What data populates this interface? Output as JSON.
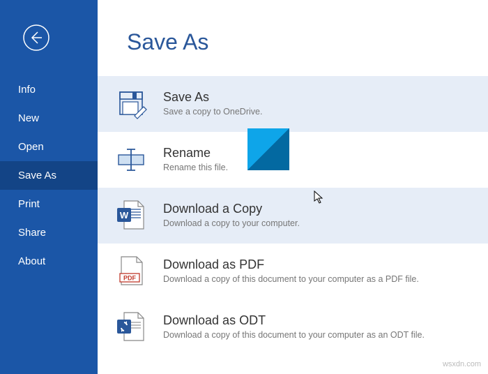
{
  "page_title": "Save As",
  "sidebar": {
    "items": [
      {
        "key": "info",
        "label": "Info",
        "selected": false
      },
      {
        "key": "new",
        "label": "New",
        "selected": false
      },
      {
        "key": "open",
        "label": "Open",
        "selected": false
      },
      {
        "key": "saveas",
        "label": "Save As",
        "selected": true
      },
      {
        "key": "print",
        "label": "Print",
        "selected": false
      },
      {
        "key": "share",
        "label": "Share",
        "selected": false
      },
      {
        "key": "about",
        "label": "About",
        "selected": false
      }
    ]
  },
  "options": [
    {
      "key": "save-as",
      "title": "Save As",
      "desc": "Save a copy to OneDrive.",
      "highlight": true
    },
    {
      "key": "rename",
      "title": "Rename",
      "desc": "Rename this file.",
      "highlight": false
    },
    {
      "key": "download-copy",
      "title": "Download a Copy",
      "desc": "Download a copy to your computer.",
      "highlight": true
    },
    {
      "key": "download-pdf",
      "title": "Download as PDF",
      "desc": "Download a copy of this document to your computer as a PDF file.",
      "highlight": false
    },
    {
      "key": "download-odt",
      "title": "Download as ODT",
      "desc": "Download a copy of this document to your computer as an ODT file.",
      "highlight": false
    }
  ],
  "colors": {
    "sidebar_bg": "#1b56a7",
    "sidebar_selected": "#134486",
    "title": "#2a579a",
    "highlight_row": "#e6edf7",
    "desc_text": "#767676"
  },
  "watermark": "wsxdn.com"
}
